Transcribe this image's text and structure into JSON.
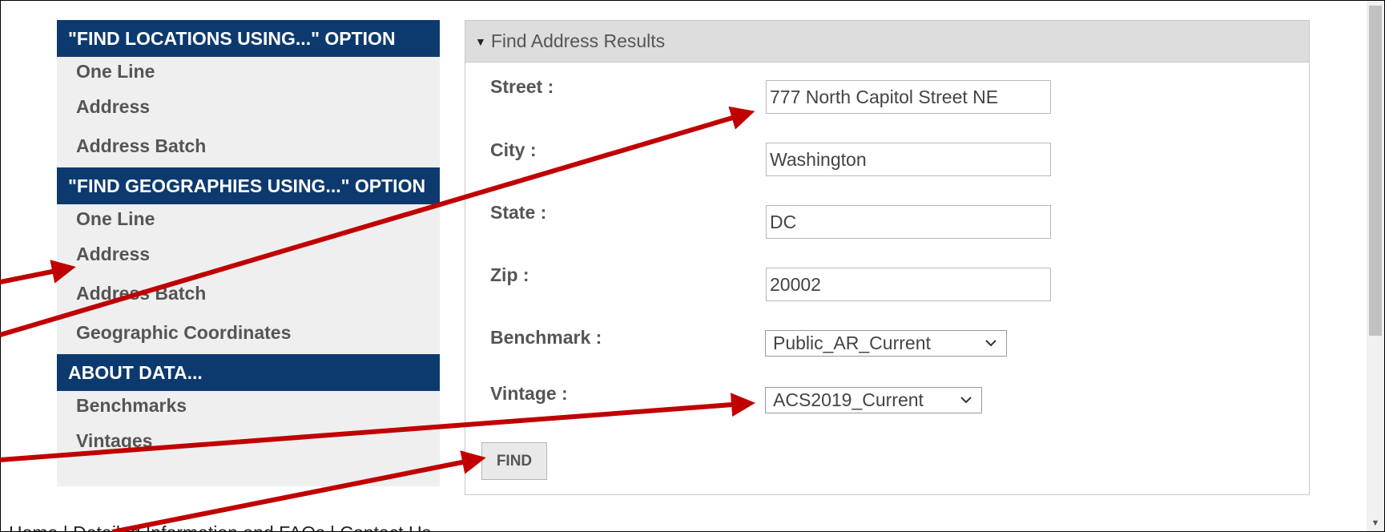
{
  "sidebar": {
    "sections": [
      {
        "title": "\"FIND LOCATIONS USING...\" OPTION",
        "items": [
          "One Line",
          "Address",
          "Address Batch"
        ]
      },
      {
        "title": "\"FIND GEOGRAPHIES USING...\" OPTION",
        "items": [
          "One Line",
          "Address",
          "Address Batch",
          "Geographic Coordinates"
        ]
      },
      {
        "title": "ABOUT DATA...",
        "items": [
          "Benchmarks",
          "Vintages"
        ]
      }
    ]
  },
  "panel": {
    "header": "Find Address Results",
    "street_label": "Street :",
    "street_value": "777 North Capitol Street NE",
    "city_label": "City :",
    "city_value": "Washington",
    "state_label": "State :",
    "state_value": "DC",
    "zip_label": "Zip :",
    "zip_value": "20002",
    "benchmark_label": "Benchmark :",
    "benchmark_value": "Public_AR_Current",
    "vintage_label": "Vintage :",
    "vintage_value": "ACS2019_Current",
    "find_label": "FIND"
  },
  "footer": {
    "home": "Home",
    "sep1": " | ",
    "details": "Detailed Information and FAQs",
    "sep2": " | ",
    "contact": "Contact Us"
  },
  "colors": {
    "section_header": "#0d3a6e",
    "sidebar_bg": "#efefef",
    "arrow": "#c00000",
    "panel_header_bg": "#dddddd"
  },
  "icons": {
    "panel_caret": "caret-down-icon",
    "select_chevron": "chevron-down-icon",
    "scroll_down": "scroll-down-arrow-icon"
  }
}
